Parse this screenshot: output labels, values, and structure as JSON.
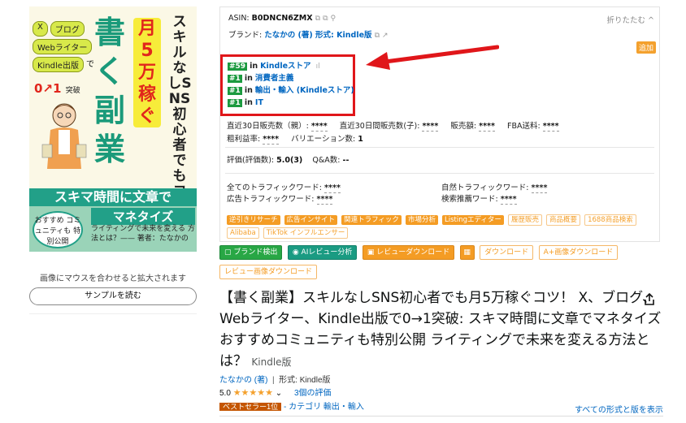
{
  "cover": {
    "tags": [
      "X",
      "ブログ",
      "Webライター",
      "Kindle出版",
      "で"
    ],
    "zero_to_one": "0↗1",
    "breakthrough": "突破",
    "kaku": "書く副業",
    "tsuki": "月5万稼ぐ",
    "vertical": "スキルなしSNS初心者でもコツ！",
    "band": "スキマ時間に文章で",
    "recommend": "おすすめ コミュニティも 特別公開",
    "manetize": "マネタイズ",
    "subtitle": "ライティングで未来を変える 方法とは？—— 著者：たなかの"
  },
  "left": {
    "hover_text": "画像にマウスを合わせると拡大されます",
    "sample_button": "サンプルを読む"
  },
  "panel": {
    "asin_label": "ASIN:",
    "asin": "B0DNCN6ZMX",
    "fold": "折りたたむ ^",
    "brand_label": "ブランド:",
    "brand_value": "たなかの (著) 形式: Kindle版",
    "add_badge": "追加",
    "ranks": [
      {
        "num": "#59",
        "in": "in",
        "cat": "Kindleストア"
      },
      {
        "num": "#1",
        "in": "in",
        "cat": "消費者主義"
      },
      {
        "num": "#1",
        "in": "in",
        "cat": "輸出・輸入 (Kindleストア)"
      },
      {
        "num": "#1",
        "in": "in",
        "cat": "IT"
      }
    ],
    "stats1": [
      {
        "label": "直近30日販売数（親）:",
        "value": "****"
      },
      {
        "label": "直近30日間販売数(子):",
        "value": "****"
      },
      {
        "label": "販売額:",
        "value": "****"
      },
      {
        "label": "FBA送料:",
        "value": "****"
      }
    ],
    "stats2": [
      {
        "label": "粗利益率:",
        "value": "****"
      },
      {
        "label": "バリエーション数:",
        "value": "1"
      }
    ],
    "rating_label": "評価(評価数):",
    "rating_value": "5.0(3)",
    "qa_label": "Q&A数:",
    "qa_value": "--",
    "traffic_left": [
      {
        "label": "全てのトラフィックワード:",
        "value": "****"
      },
      {
        "label": "広告トラフィックワード:",
        "value": "****"
      }
    ],
    "traffic_right": [
      {
        "label": "自然トラフィックワード:",
        "value": "****"
      },
      {
        "label": "検索推薦ワード:",
        "value": "****"
      }
    ],
    "tools_on": [
      "逆引きリサーチ",
      "広告インサイト",
      "関連トラフィック",
      "市場分析",
      "Listingエディター"
    ],
    "tools_off": [
      "履歴販売",
      "商品概要",
      "1688商品検索",
      "Alibaba",
      "TikTok インフルエンサー"
    ]
  },
  "actions": {
    "brand_detect": "▢ ブランド検出",
    "ai_review": "AIレビュー分析",
    "review_download": "レビューダウンロード",
    "download": "ダウンロード",
    "aplus_download": "A+画像ダウンロード",
    "review_image_download": "レビュー画像ダウンロード"
  },
  "product": {
    "title": "【書く副業】スキルなしSNS初心者でも月5万稼ぐコツ！ X、ブログ、Webライター、Kindle出版で0→1突破: スキマ時間に文章でマネタイズ おすすめコミュニティも特別公開 ライティングで未来を変える方法とは？",
    "format": "Kindle版",
    "author": "たなかの (著)",
    "format_label": "形式: Kindle版",
    "rating": "5.0",
    "stars": "★★★★★",
    "review_count": "3個の評価",
    "bestseller": "ベストセラー1位",
    "category_prefix": "- カテゴリ",
    "category": "輸出・輸入",
    "all_formats": "すべての形式と版を表示"
  }
}
